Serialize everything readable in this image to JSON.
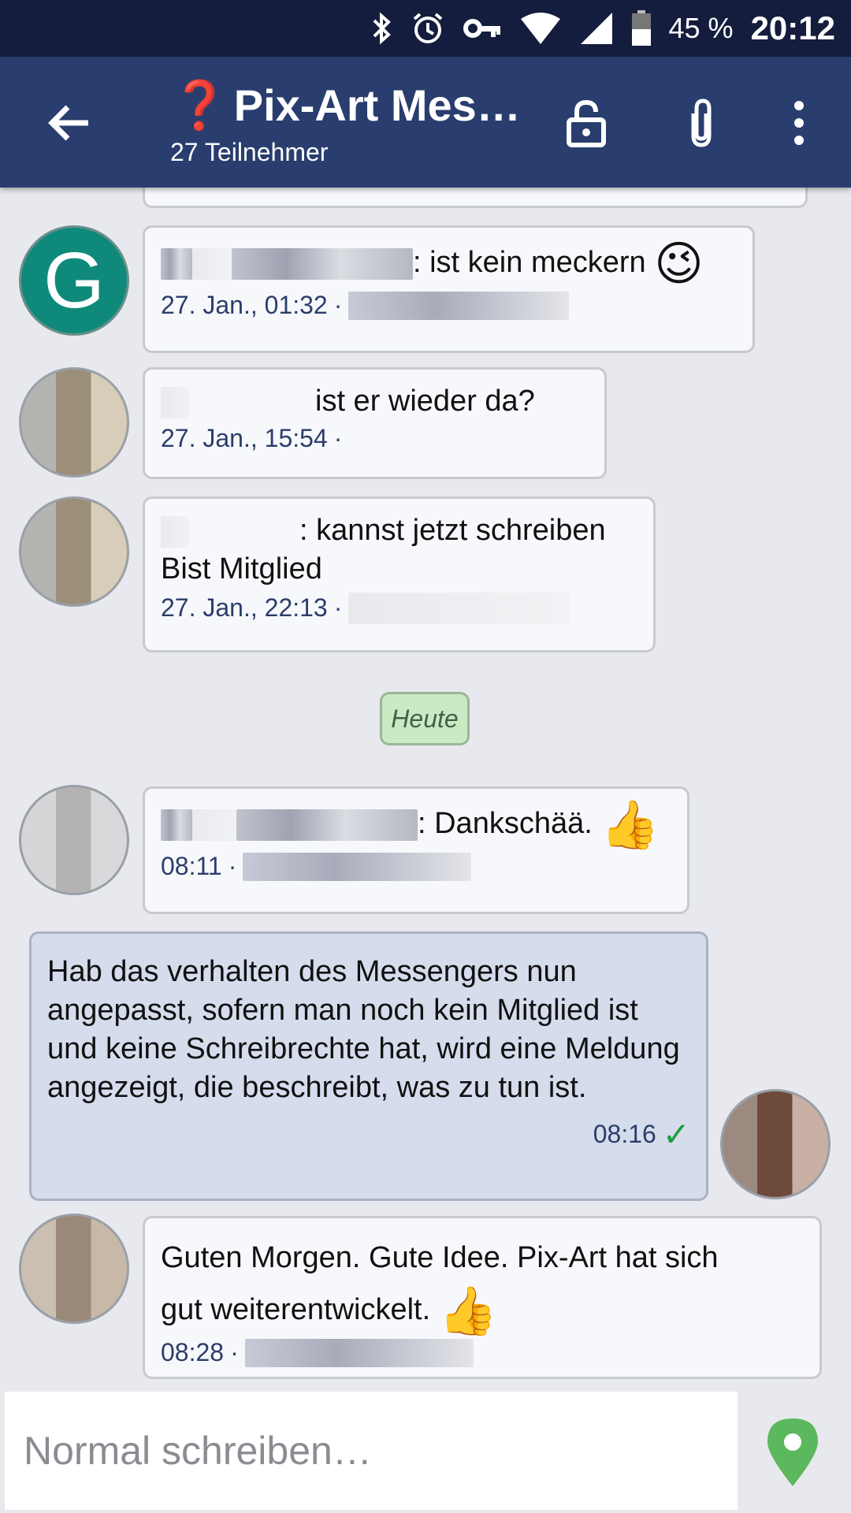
{
  "status_bar": {
    "battery": "45 %",
    "time": "20:12"
  },
  "app_bar": {
    "title": "Pix-Art Mes…",
    "subtitle": "27 Teilnehmer"
  },
  "messages": [
    {
      "time": "27. Jan., 01:32",
      "text": ": ist kein meckern",
      "emoji": "😉",
      "avatar_letter": "G"
    },
    {
      "time": "27. Jan., 15:54",
      "text": "ist er wieder da?"
    },
    {
      "time": "27. Jan., 22:13",
      "text_line1": ": kannst jetzt schreiben",
      "text_line2": "Bist Mitglied"
    },
    {
      "time": "08:11",
      "text": ": Dankschää.",
      "emoji": "👍"
    },
    {
      "time": "08:16",
      "text": "Hab das verhalten des Messengers nun angepasst, sofern man noch kein Mitglied ist und keine Schreibrechte hat, wird eine Meldung angezeigt, die beschreibt, was zu tun ist.",
      "status": "✓"
    },
    {
      "time": "08:28",
      "text_line1": "Guten Morgen. Gute Idee. Pix-Art hat sich",
      "text_line2": "gut weiterentwickelt.",
      "emoji": "👍"
    }
  ],
  "day_separator": "Heute",
  "compose": {
    "placeholder": "Normal schreiben…"
  },
  "meta_separator": "·",
  "colors": {
    "status_bar": "#141d3d",
    "app_bar": "#293d6e",
    "own_bubble": "#d5dcec",
    "day_chip": "#c9ebc3",
    "location_icon": "#5cb85c"
  }
}
